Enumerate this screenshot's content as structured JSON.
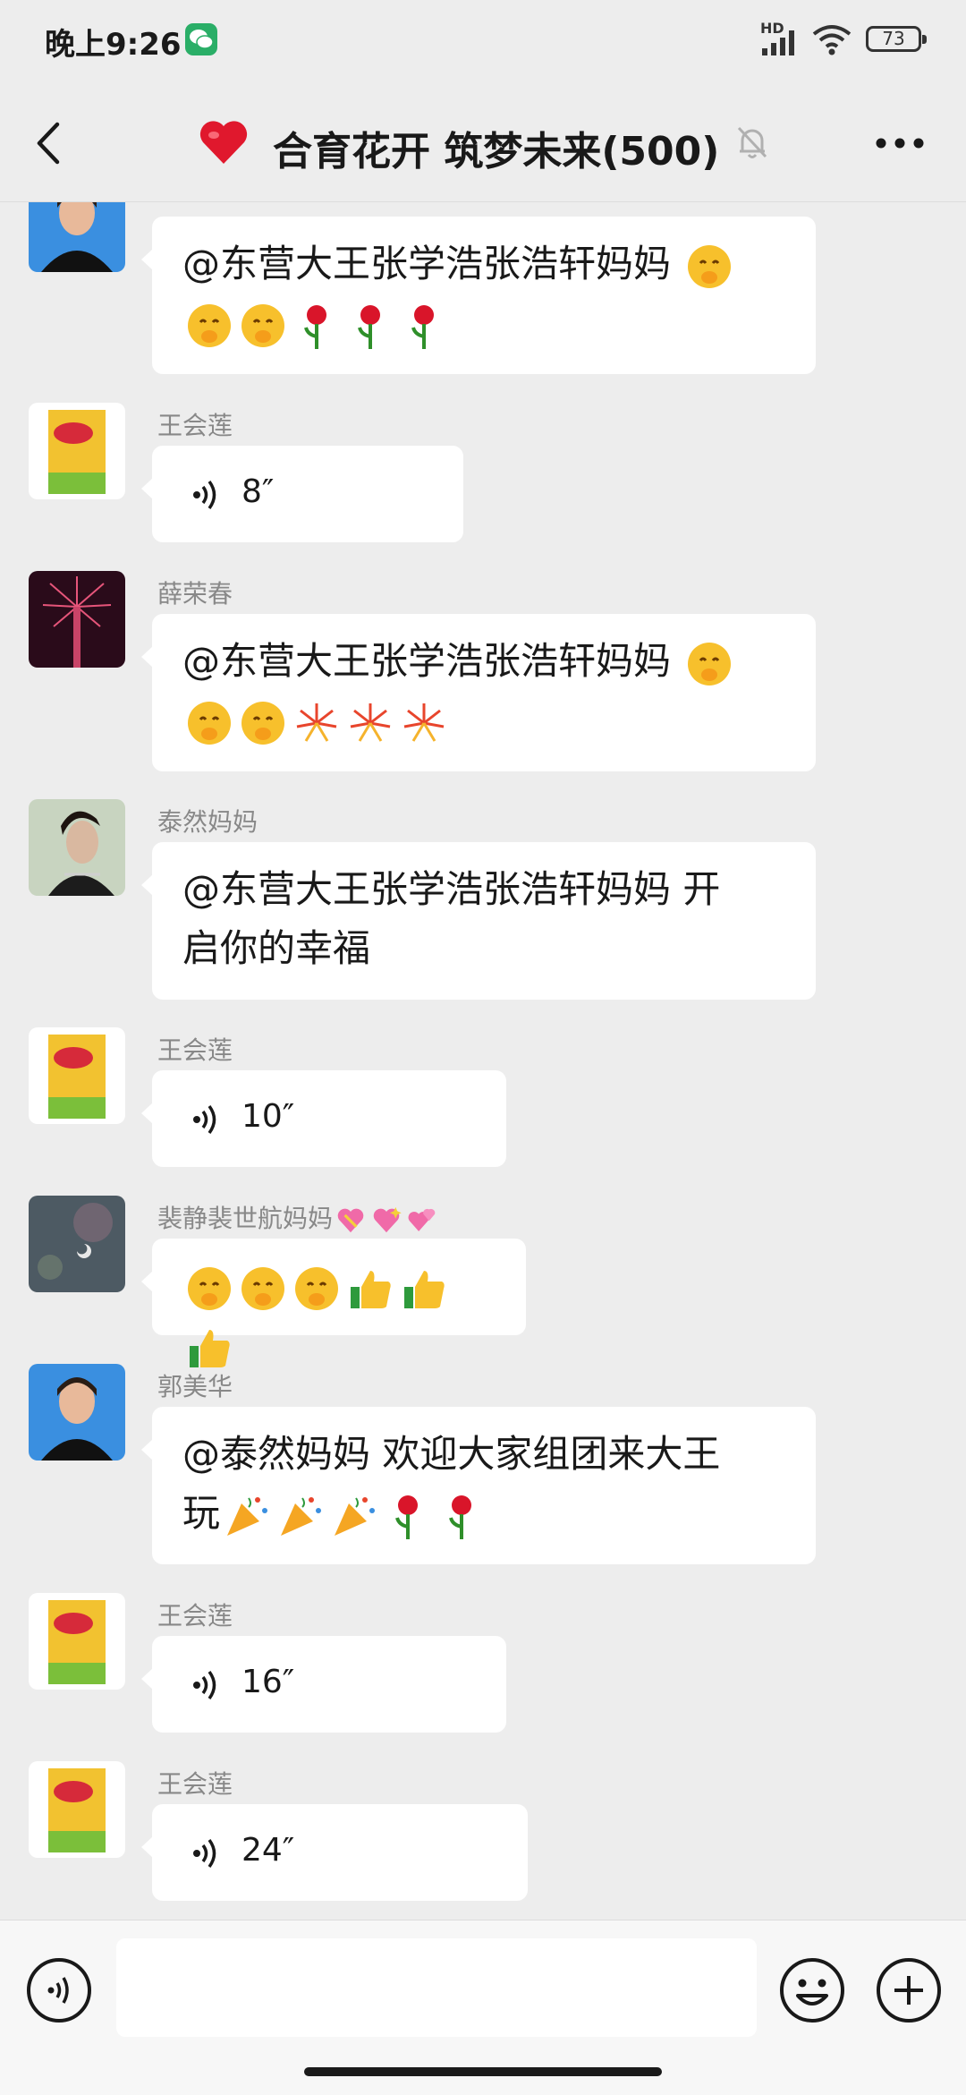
{
  "status_bar": {
    "time": "晚上9:26",
    "network_label": "HD",
    "battery": "73"
  },
  "header": {
    "title": "合育花开 筑梦未来(500)",
    "back_icon": "chevron-left-icon",
    "title_icon": "red-heart-icon",
    "mute_icon": "bell-muted-icon",
    "more_icon": "more-dots-icon"
  },
  "messages": [
    {
      "sender": "",
      "type": "text",
      "text": "@东营大王张学浩张浩轩妈妈 ",
      "emojis": [
        "shush",
        "shush",
        "shush",
        "rose",
        "rose",
        "rose"
      ]
    },
    {
      "sender": "王会莲",
      "type": "voice",
      "duration": "8″"
    },
    {
      "sender": "薛荣春",
      "type": "text",
      "text": "@东营大王张学浩张浩轩妈妈 ",
      "emojis": [
        "shush",
        "shush",
        "shush",
        "fireworks",
        "fireworks",
        "fireworks"
      ]
    },
    {
      "sender": "泰然妈妈",
      "type": "text",
      "text_line1": "@东营大王张学浩张浩轩妈妈  开",
      "text_line2": "启你的幸福"
    },
    {
      "sender": "王会莲",
      "type": "voice",
      "duration": "10″"
    },
    {
      "sender": "裴静裴世航妈妈",
      "type": "text",
      "name_emojis": [
        "heart-ribbon",
        "sparkle-heart",
        "two-hearts"
      ],
      "emojis": [
        "shush",
        "shush",
        "shush",
        "thumbs-up",
        "thumbs-up",
        "thumbs-up"
      ]
    },
    {
      "sender": "郭美华",
      "type": "text",
      "text_line1": "@泰然妈妈  欢迎大家组团来大王",
      "text_line2": "玩",
      "emojis": [
        "party-popper",
        "party-popper",
        "party-popper",
        "rose",
        "rose"
      ]
    },
    {
      "sender": "王会莲",
      "type": "voice",
      "duration": "16″"
    },
    {
      "sender": "王会莲",
      "type": "voice",
      "duration": "24″"
    }
  ],
  "input_bar": {
    "voice_icon": "voice-toggle-icon",
    "emoji_icon": "smiley-icon",
    "plus_icon": "plus-circle-icon",
    "input_value": ""
  },
  "colors": {
    "background": "#ededed",
    "bubble": "#ffffff",
    "wechat_green": "#2aae67",
    "sender_gray": "#888888"
  }
}
